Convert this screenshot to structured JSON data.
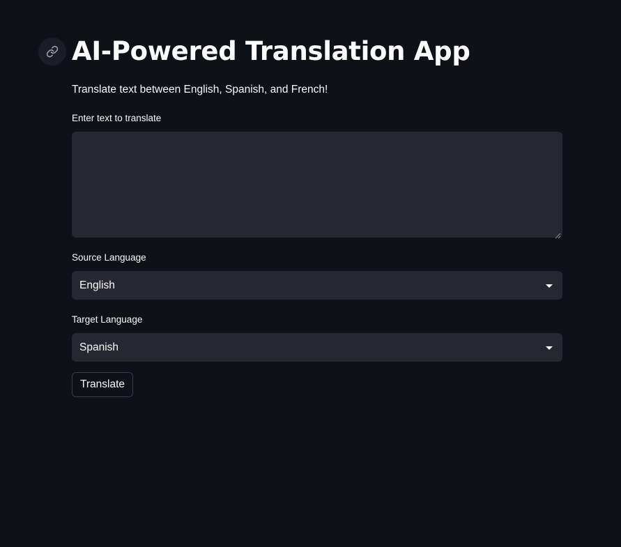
{
  "page": {
    "title": "AI-Powered Translation App",
    "subtitle": "Translate text between English, Spanish, and French!"
  },
  "icons": {
    "anchor": "link-icon",
    "source_dropdown": "caret-down-icon",
    "target_dropdown": "caret-down-icon",
    "textarea_resize": "resize-grip-icon"
  },
  "form": {
    "text_input": {
      "label": "Enter text to translate",
      "value": "",
      "placeholder": ""
    },
    "source_language": {
      "label": "Source Language",
      "selected": "English"
    },
    "target_language": {
      "label": "Target Language",
      "selected": "Spanish"
    },
    "translate_button": {
      "label": "Translate"
    }
  },
  "colors": {
    "background": "#0e1117",
    "input_background": "#262730",
    "text": "#fafafa",
    "button_border": "#3a3c46"
  }
}
